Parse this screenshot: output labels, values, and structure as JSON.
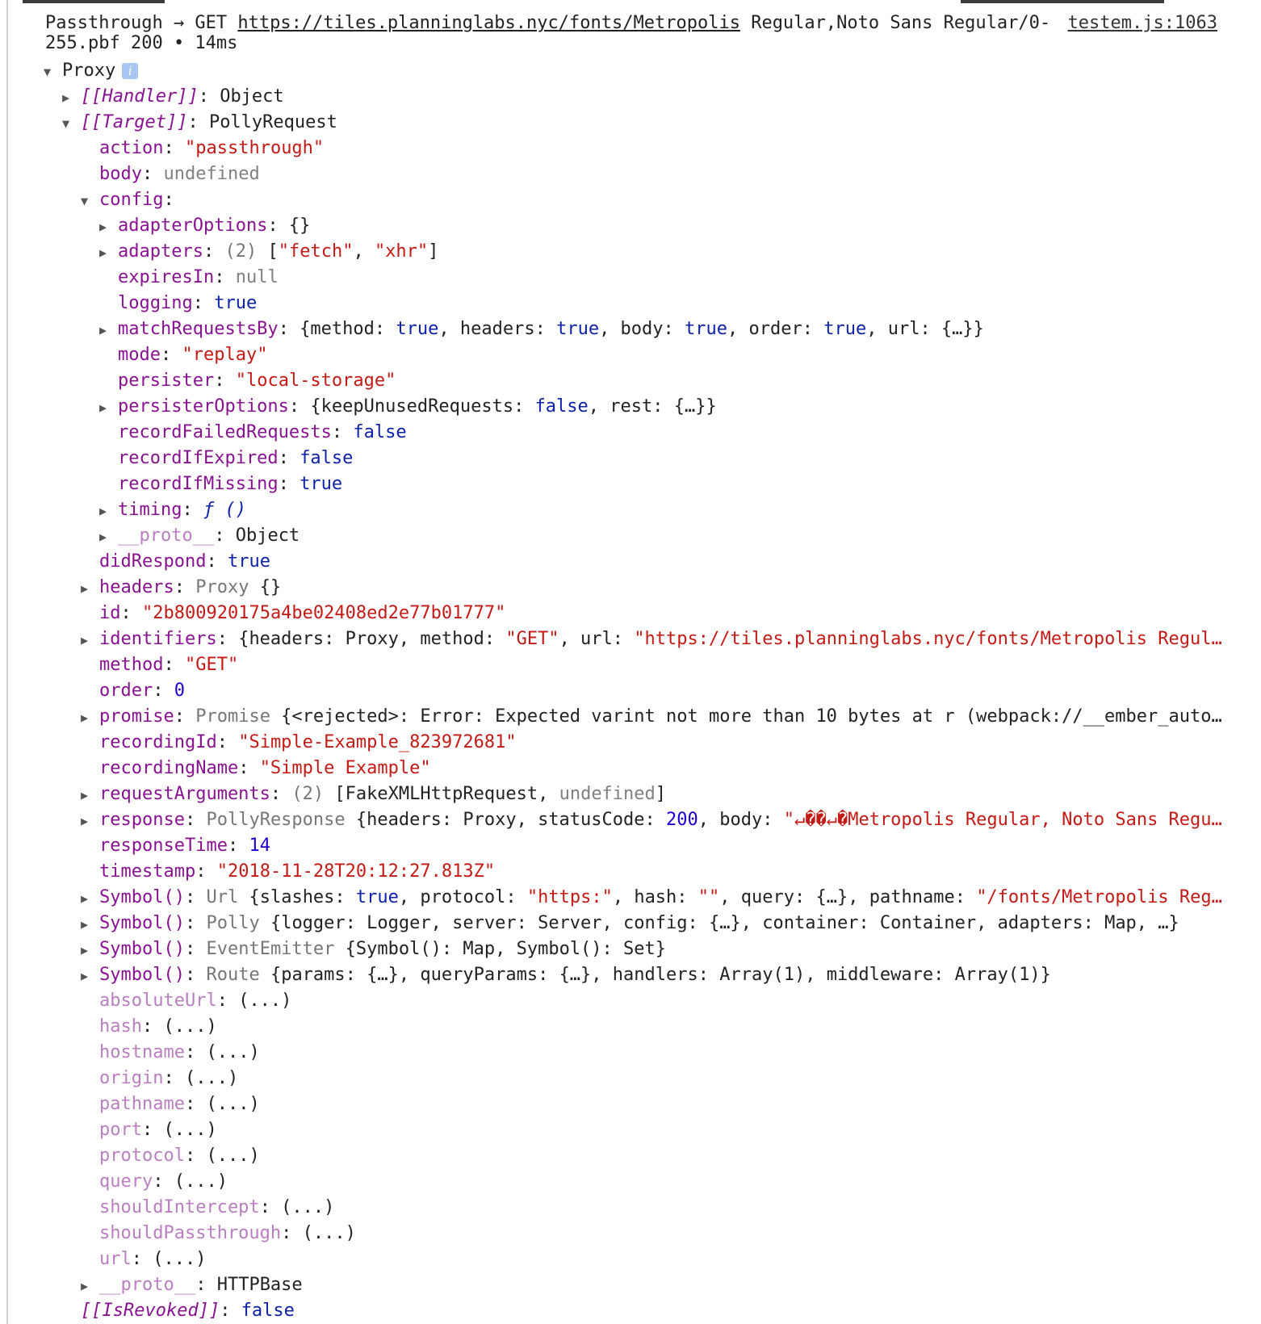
{
  "header": {
    "prefix": "Passthrough → GET ",
    "url": "https://tiles.planninglabs.nyc/fonts/Metropolis",
    "rest_line1": " Regular,Noto Sans Regular/0-",
    "rest_line2": "255.pbf 200 • 14ms",
    "source": "testem.js:1063"
  },
  "rows": [
    {
      "i": 0,
      "t": "open",
      "segs": [
        [
          "p",
          "Proxy"
        ],
        [
          "badge",
          "i"
        ]
      ]
    },
    {
      "i": 1,
      "t": "closed",
      "segs": [
        [
          "ki",
          "[[Handler]]"
        ],
        [
          "p",
          ": Object"
        ]
      ]
    },
    {
      "i": 1,
      "t": "open",
      "segs": [
        [
          "ki",
          "[[Target]]"
        ],
        [
          "p",
          ": PollyRequest"
        ]
      ]
    },
    {
      "i": 2,
      "t": "leaf",
      "segs": [
        [
          "k",
          "action"
        ],
        [
          "p",
          ": "
        ],
        [
          "s",
          "\"passthrough\""
        ]
      ]
    },
    {
      "i": 2,
      "t": "leaf",
      "segs": [
        [
          "k",
          "body"
        ],
        [
          "p",
          ": "
        ],
        [
          "u",
          "undefined"
        ]
      ]
    },
    {
      "i": 2,
      "t": "open",
      "segs": [
        [
          "k",
          "config"
        ],
        [
          "p",
          ":"
        ]
      ]
    },
    {
      "i": 3,
      "t": "closed",
      "segs": [
        [
          "k",
          "adapterOptions"
        ],
        [
          "p",
          ": {}"
        ]
      ]
    },
    {
      "i": 3,
      "t": "closed",
      "segs": [
        [
          "k",
          "adapters"
        ],
        [
          "p",
          ": "
        ],
        [
          "c",
          "(2)"
        ],
        [
          "p",
          " ["
        ],
        [
          "s",
          "\"fetch\""
        ],
        [
          "p",
          ", "
        ],
        [
          "s",
          "\"xhr\""
        ],
        [
          "p",
          "]"
        ]
      ]
    },
    {
      "i": 3,
      "t": "leaf",
      "segs": [
        [
          "k",
          "expiresIn"
        ],
        [
          "p",
          ": "
        ],
        [
          "u",
          "null"
        ]
      ]
    },
    {
      "i": 3,
      "t": "leaf",
      "segs": [
        [
          "k",
          "logging"
        ],
        [
          "p",
          ": "
        ],
        [
          "b",
          "true"
        ]
      ]
    },
    {
      "i": 3,
      "t": "closed",
      "segs": [
        [
          "k",
          "matchRequestsBy"
        ],
        [
          "p",
          ": {method: "
        ],
        [
          "b",
          "true"
        ],
        [
          "p",
          ", headers: "
        ],
        [
          "b",
          "true"
        ],
        [
          "p",
          ", body: "
        ],
        [
          "b",
          "true"
        ],
        [
          "p",
          ", order: "
        ],
        [
          "b",
          "true"
        ],
        [
          "p",
          ", url: {…}}"
        ]
      ]
    },
    {
      "i": 3,
      "t": "leaf",
      "segs": [
        [
          "k",
          "mode"
        ],
        [
          "p",
          ": "
        ],
        [
          "s",
          "\"replay\""
        ]
      ]
    },
    {
      "i": 3,
      "t": "leaf",
      "segs": [
        [
          "k",
          "persister"
        ],
        [
          "p",
          ": "
        ],
        [
          "s",
          "\"local-storage\""
        ]
      ]
    },
    {
      "i": 3,
      "t": "closed",
      "segs": [
        [
          "k",
          "persisterOptions"
        ],
        [
          "p",
          ": {keepUnusedRequests: "
        ],
        [
          "b",
          "false"
        ],
        [
          "p",
          ", rest: {…}}"
        ]
      ]
    },
    {
      "i": 3,
      "t": "leaf",
      "segs": [
        [
          "k",
          "recordFailedRequests"
        ],
        [
          "p",
          ": "
        ],
        [
          "b",
          "false"
        ]
      ]
    },
    {
      "i": 3,
      "t": "leaf",
      "segs": [
        [
          "k",
          "recordIfExpired"
        ],
        [
          "p",
          ": "
        ],
        [
          "b",
          "false"
        ]
      ]
    },
    {
      "i": 3,
      "t": "leaf",
      "segs": [
        [
          "k",
          "recordIfMissing"
        ],
        [
          "p",
          ": "
        ],
        [
          "b",
          "true"
        ]
      ]
    },
    {
      "i": 3,
      "t": "closed",
      "segs": [
        [
          "k",
          "timing"
        ],
        [
          "p",
          ": "
        ],
        [
          "f",
          "ƒ ()"
        ]
      ]
    },
    {
      "i": 3,
      "t": "closed",
      "segs": [
        [
          "kd",
          "__proto__"
        ],
        [
          "p",
          ": Object"
        ]
      ]
    },
    {
      "i": 2,
      "t": "leaf",
      "segs": [
        [
          "k",
          "didRespond"
        ],
        [
          "p",
          ": "
        ],
        [
          "b",
          "true"
        ]
      ]
    },
    {
      "i": 2,
      "t": "closed",
      "segs": [
        [
          "k",
          "headers"
        ],
        [
          "p",
          ": "
        ],
        [
          "c",
          "Proxy"
        ],
        [
          "p",
          " {}"
        ]
      ]
    },
    {
      "i": 2,
      "t": "leaf",
      "segs": [
        [
          "k",
          "id"
        ],
        [
          "p",
          ": "
        ],
        [
          "s",
          "\"2b800920175a4be02408ed2e77b01777\""
        ]
      ]
    },
    {
      "i": 2,
      "t": "closed",
      "segs": [
        [
          "k",
          "identifiers"
        ],
        [
          "p",
          ": {headers: Proxy, method: "
        ],
        [
          "s",
          "\"GET\""
        ],
        [
          "p",
          ", url: "
        ],
        [
          "s",
          "\"https://tiles.planninglabs.nyc/fonts/Metropolis Regul…"
        ]
      ]
    },
    {
      "i": 2,
      "t": "leaf",
      "segs": [
        [
          "k",
          "method"
        ],
        [
          "p",
          ": "
        ],
        [
          "s",
          "\"GET\""
        ]
      ]
    },
    {
      "i": 2,
      "t": "leaf",
      "segs": [
        [
          "k",
          "order"
        ],
        [
          "p",
          ": "
        ],
        [
          "n",
          "0"
        ]
      ]
    },
    {
      "i": 2,
      "t": "closed",
      "segs": [
        [
          "k",
          "promise"
        ],
        [
          "p",
          ": "
        ],
        [
          "c",
          "Promise"
        ],
        [
          "p",
          " {<rejected>: Error: Expected varint not more than 10 bytes at r (webpack://__ember_auto…"
        ]
      ]
    },
    {
      "i": 2,
      "t": "leaf",
      "segs": [
        [
          "k",
          "recordingId"
        ],
        [
          "p",
          ": "
        ],
        [
          "s",
          "\"Simple-Example_823972681\""
        ]
      ]
    },
    {
      "i": 2,
      "t": "leaf",
      "segs": [
        [
          "k",
          "recordingName"
        ],
        [
          "p",
          ": "
        ],
        [
          "s",
          "\"Simple Example\""
        ]
      ]
    },
    {
      "i": 2,
      "t": "closed",
      "segs": [
        [
          "k",
          "requestArguments"
        ],
        [
          "p",
          ": "
        ],
        [
          "c",
          "(2)"
        ],
        [
          "p",
          " [FakeXMLHttpRequest, "
        ],
        [
          "u",
          "undefined"
        ],
        [
          "p",
          "]"
        ]
      ]
    },
    {
      "i": 2,
      "t": "closed",
      "segs": [
        [
          "k",
          "response"
        ],
        [
          "p",
          ": "
        ],
        [
          "c",
          "PollyResponse"
        ],
        [
          "p",
          " {headers: Proxy, statusCode: "
        ],
        [
          "n",
          "200"
        ],
        [
          "p",
          ", body: "
        ],
        [
          "s",
          "\"↵��↵�Metropolis Regular, Noto Sans Regu…"
        ]
      ]
    },
    {
      "i": 2,
      "t": "leaf",
      "segs": [
        [
          "k",
          "responseTime"
        ],
        [
          "p",
          ": "
        ],
        [
          "n",
          "14"
        ]
      ]
    },
    {
      "i": 2,
      "t": "leaf",
      "segs": [
        [
          "k",
          "timestamp"
        ],
        [
          "p",
          ": "
        ],
        [
          "s",
          "\"2018-11-28T20:12:27.813Z\""
        ]
      ]
    },
    {
      "i": 2,
      "t": "closed",
      "segs": [
        [
          "k",
          "Symbol()"
        ],
        [
          "p",
          ": "
        ],
        [
          "c",
          "Url"
        ],
        [
          "p",
          " {slashes: "
        ],
        [
          "b",
          "true"
        ],
        [
          "p",
          ", protocol: "
        ],
        [
          "s",
          "\"https:\""
        ],
        [
          "p",
          ", hash: "
        ],
        [
          "s",
          "\"\""
        ],
        [
          "p",
          ", query: {…}, pathname: "
        ],
        [
          "s",
          "\"/fonts/Metropolis Reg…"
        ]
      ]
    },
    {
      "i": 2,
      "t": "closed",
      "segs": [
        [
          "k",
          "Symbol()"
        ],
        [
          "p",
          ": "
        ],
        [
          "c",
          "Polly"
        ],
        [
          "p",
          " {logger: Logger, server: Server, config: {…}, container: Container, adapters: Map, …}"
        ]
      ]
    },
    {
      "i": 2,
      "t": "closed",
      "segs": [
        [
          "k",
          "Symbol()"
        ],
        [
          "p",
          ": "
        ],
        [
          "c",
          "EventEmitter"
        ],
        [
          "p",
          " {Symbol(): Map, Symbol(): Set}"
        ]
      ]
    },
    {
      "i": 2,
      "t": "closed",
      "segs": [
        [
          "k",
          "Symbol()"
        ],
        [
          "p",
          ": "
        ],
        [
          "c",
          "Route"
        ],
        [
          "p",
          " {params: {…}, queryParams: {…}, handlers: Array(1), middleware: Array(1)}"
        ]
      ]
    },
    {
      "i": 2,
      "t": "leaf",
      "segs": [
        [
          "kd",
          "absoluteUrl"
        ],
        [
          "p",
          ": (...)"
        ]
      ]
    },
    {
      "i": 2,
      "t": "leaf",
      "segs": [
        [
          "kd",
          "hash"
        ],
        [
          "p",
          ": (...)"
        ]
      ]
    },
    {
      "i": 2,
      "t": "leaf",
      "segs": [
        [
          "kd",
          "hostname"
        ],
        [
          "p",
          ": (...)"
        ]
      ]
    },
    {
      "i": 2,
      "t": "leaf",
      "segs": [
        [
          "kd",
          "origin"
        ],
        [
          "p",
          ": (...)"
        ]
      ]
    },
    {
      "i": 2,
      "t": "leaf",
      "segs": [
        [
          "kd",
          "pathname"
        ],
        [
          "p",
          ": (...)"
        ]
      ]
    },
    {
      "i": 2,
      "t": "leaf",
      "segs": [
        [
          "kd",
          "port"
        ],
        [
          "p",
          ": (...)"
        ]
      ]
    },
    {
      "i": 2,
      "t": "leaf",
      "segs": [
        [
          "kd",
          "protocol"
        ],
        [
          "p",
          ": (...)"
        ]
      ]
    },
    {
      "i": 2,
      "t": "leaf",
      "segs": [
        [
          "kd",
          "query"
        ],
        [
          "p",
          ": (...)"
        ]
      ]
    },
    {
      "i": 2,
      "t": "leaf",
      "segs": [
        [
          "kd",
          "shouldIntercept"
        ],
        [
          "p",
          ": (...)"
        ]
      ]
    },
    {
      "i": 2,
      "t": "leaf",
      "segs": [
        [
          "kd",
          "shouldPassthrough"
        ],
        [
          "p",
          ": (...)"
        ]
      ]
    },
    {
      "i": 2,
      "t": "leaf",
      "segs": [
        [
          "kd",
          "url"
        ],
        [
          "p",
          ": (...)"
        ]
      ]
    },
    {
      "i": 2,
      "t": "closed",
      "segs": [
        [
          "kd",
          "__proto__"
        ],
        [
          "p",
          ": HTTPBase"
        ]
      ]
    },
    {
      "i": 1,
      "t": "leaf",
      "segs": [
        [
          "ki",
          "[[IsRevoked]]"
        ],
        [
          "p",
          ": "
        ],
        [
          "b",
          "false"
        ]
      ]
    }
  ],
  "colors": {
    "key": "#881391",
    "key_dim": "#b97fc0",
    "string": "#c41a16",
    "number": "#1c00cf",
    "boolean": "#0d22aa",
    "undefined": "#808080"
  }
}
